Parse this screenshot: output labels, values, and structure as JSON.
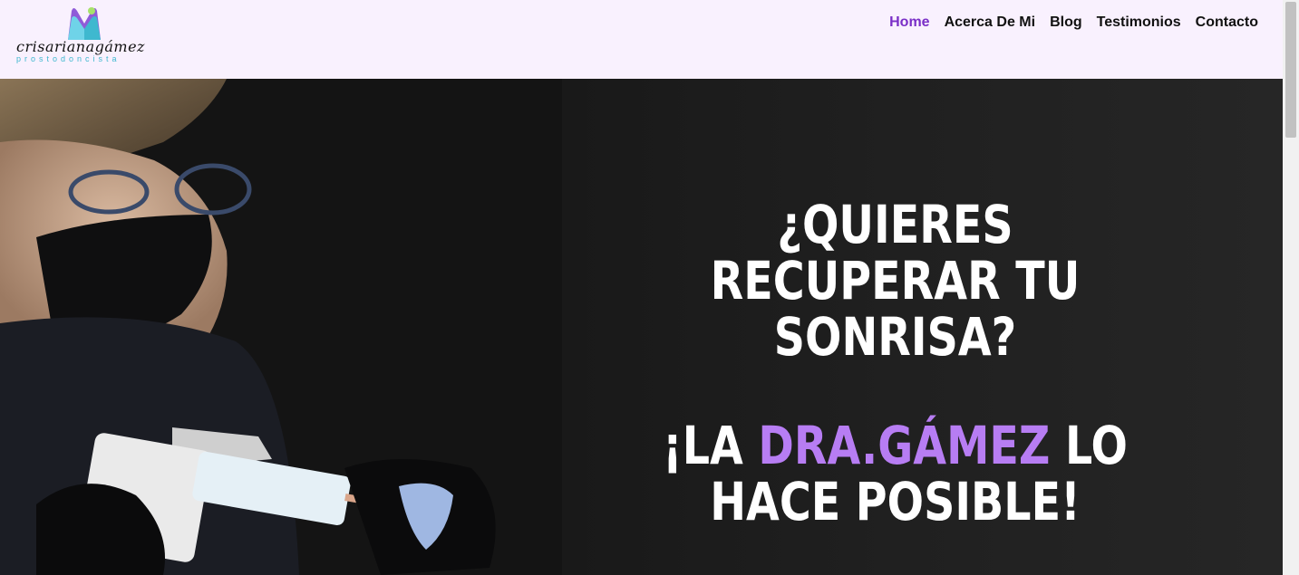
{
  "logo": {
    "script_text": "crisarianagámez",
    "subtitle": "prostodoncista",
    "colors": [
      "#6fd3e8",
      "#8f5bd8",
      "#a7e26b",
      "#3fb8cf"
    ]
  },
  "nav": {
    "items": [
      {
        "label": "Home",
        "active": true
      },
      {
        "label": "Acerca De Mi"
      },
      {
        "label": "Blog"
      },
      {
        "label": "Testimonios"
      },
      {
        "label": "Contacto"
      }
    ]
  },
  "hero": {
    "headline_line1": "¿QUIERES RECUPERAR TU SONRISA?",
    "headline_line2_prefix": "¡LA ",
    "headline_line2_accent": "DRA.GÁMEZ",
    "headline_line2_suffix": " LO HACE POSIBLE!",
    "accent_color": "#b77df3",
    "photo_icon": "dentist-photo"
  }
}
